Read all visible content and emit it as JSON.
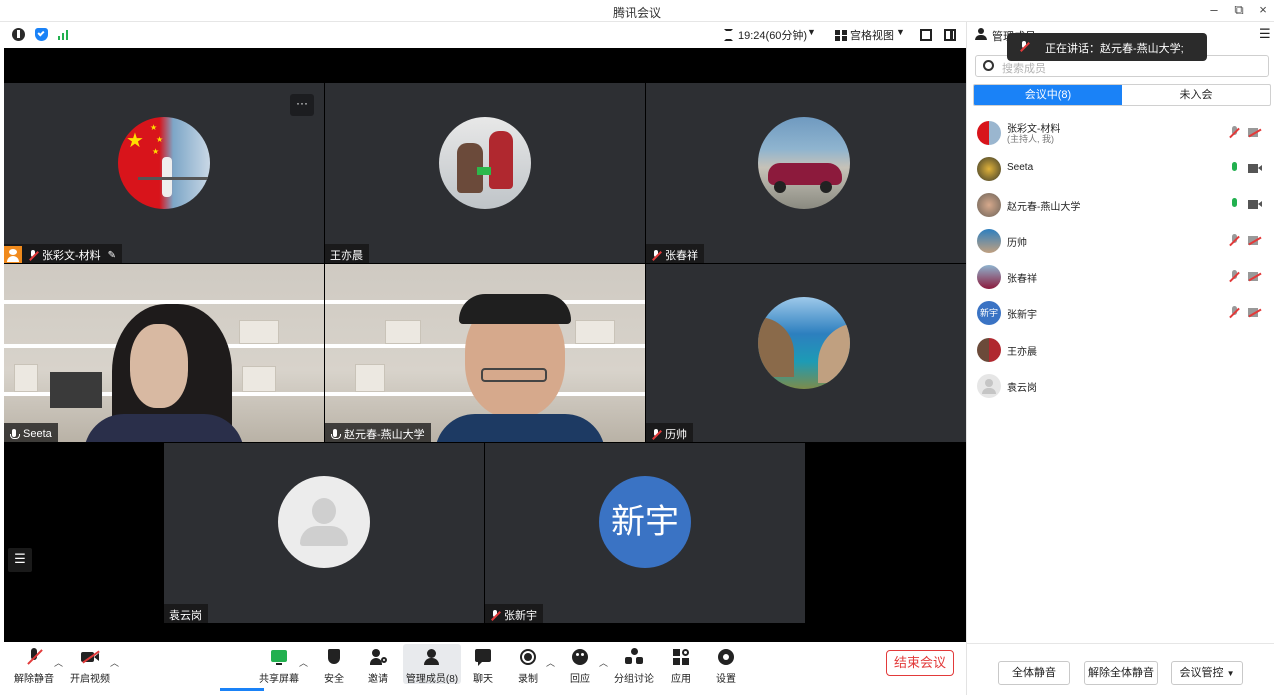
{
  "window": {
    "title": "腾讯会议",
    "min": "–",
    "restore": "⧉",
    "close": "×"
  },
  "toolbar": {
    "timer": "19:24(60分钟)",
    "view": "宫格视图"
  },
  "tiles": {
    "t1": {
      "name": "张彩文-材料"
    },
    "t2": {
      "name": "王亦晨"
    },
    "t3": {
      "name": "张春祥"
    },
    "t4": {
      "name": "Seeta"
    },
    "t5": {
      "name": "赵元春-燕山大学"
    },
    "t6": {
      "name": "历帅"
    },
    "t7": {
      "name": "袁云岗"
    },
    "t8": {
      "name": "张新宇",
      "avatar_text": "新宇"
    }
  },
  "bottombar": {
    "mute": "解除静音",
    "video": "开启视频",
    "share": "共享屏幕",
    "security": "安全",
    "invite": "邀请",
    "members": "管理成员(8)",
    "chat": "聊天",
    "record": "录制",
    "react": "回应",
    "breakout": "分组讨论",
    "apps": "应用",
    "settings": "设置",
    "end": "结束会议"
  },
  "panel": {
    "title": "管理成员",
    "search_placeholder": "搜索成员",
    "tab_in": "会议中(8)",
    "tab_out": "未入会",
    "speaking": "正在讲话：赵元春-燕山大学;",
    "members": [
      {
        "name": "张彩文-材料",
        "sub": "(主持人, 我)"
      },
      {
        "name": "Seeta",
        "sub": ""
      },
      {
        "name": "赵元春-燕山大学",
        "sub": ""
      },
      {
        "name": "历帅",
        "sub": ""
      },
      {
        "name": "张春祥",
        "sub": ""
      },
      {
        "name": "张新宇",
        "sub": "",
        "avatar_text": "新宇"
      },
      {
        "name": "王亦晨",
        "sub": ""
      },
      {
        "name": "袁云岗",
        "sub": ""
      }
    ],
    "mute_all": "全体静音",
    "unmute_all": "解除全体静音",
    "controls": "会议管控"
  },
  "colors": {
    "accent": "#1a82f7",
    "danger": "#e23a3a",
    "active_speaker": "#22b04f"
  }
}
